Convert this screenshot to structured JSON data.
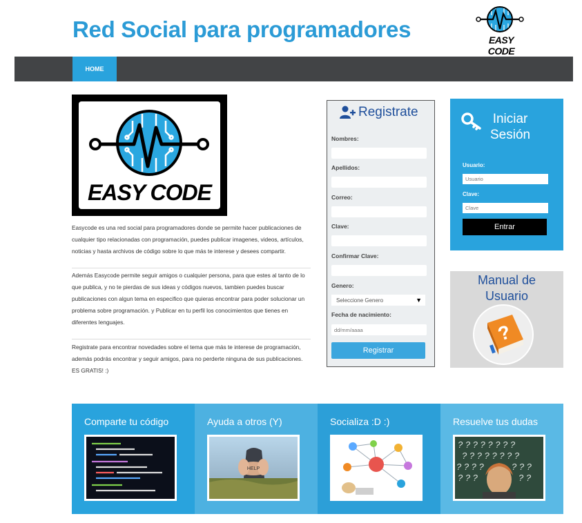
{
  "header": {
    "title": "Red Social para programadores",
    "logo_text": "EASY CODE"
  },
  "nav": {
    "home": "HOME"
  },
  "main": {
    "logo_text": "EASY CODE",
    "paragraphs": [
      "Easycode es una red social para programadores donde se permite hacer publicaciones de cualquier tipo relacionadas con programación, puedes publicar imagenes, videos, artículos, noticias y hasta archivos de código sobre lo que más te interese y desees compartir.",
      "Además Easycode permite seguir amigos o cualquier persona, para que estes al tanto de lo que publica, y no te pierdas de sus ideas y códigos nuevos, tambien puedes buscar publicaciones con algun tema en especifico que quieras encontrar para poder solucionar un problema sobre programación. y Publicar en tu perfil los conocimientos que tienes en diferentes lenguajes.",
      "Registrate para encontrar novedades sobre el tema que más te interese de programación, además podrás encontrar y seguir amigos, para no perderte ninguna de sus publicaciones. ES GRATIS! :)"
    ]
  },
  "register": {
    "title": "Registrate",
    "fields": {
      "nombres": "Nombres:",
      "apellidos": "Apellidos:",
      "correo": "Correo:",
      "clave": "Clave:",
      "confirmar": "Confirmar Clave:",
      "genero": "Genero:",
      "fecha": "Fecha de nacimiento:"
    },
    "genero_selected": "Seleccione Genero",
    "fecha_placeholder": "dd/mm/aaaa",
    "button": "Registrar"
  },
  "login": {
    "title_line1": "Iniciar",
    "title_line2": "Sesión",
    "usuario_label": "Usuario:",
    "usuario_placeholder": "Usuario",
    "clave_label": "Clave:",
    "clave_placeholder": "Clave",
    "button": "Entrar"
  },
  "manual": {
    "line1": "Manual de",
    "line2": "Usuario"
  },
  "features": [
    {
      "title": "Comparte tu código",
      "bg": "#29a3dd"
    },
    {
      "title": "Ayuda a otros (Y)",
      "bg": "#4db1e1"
    },
    {
      "title": "Socializa :D :)",
      "bg": "#2c9fd8"
    },
    {
      "title": "Resuelve tus dudas",
      "bg": "#5ab9e5"
    }
  ],
  "colors": {
    "accent": "#29a3dd",
    "title": "#2b9bd6",
    "nav": "#424446",
    "brand_dark": "#1f4f9b"
  }
}
